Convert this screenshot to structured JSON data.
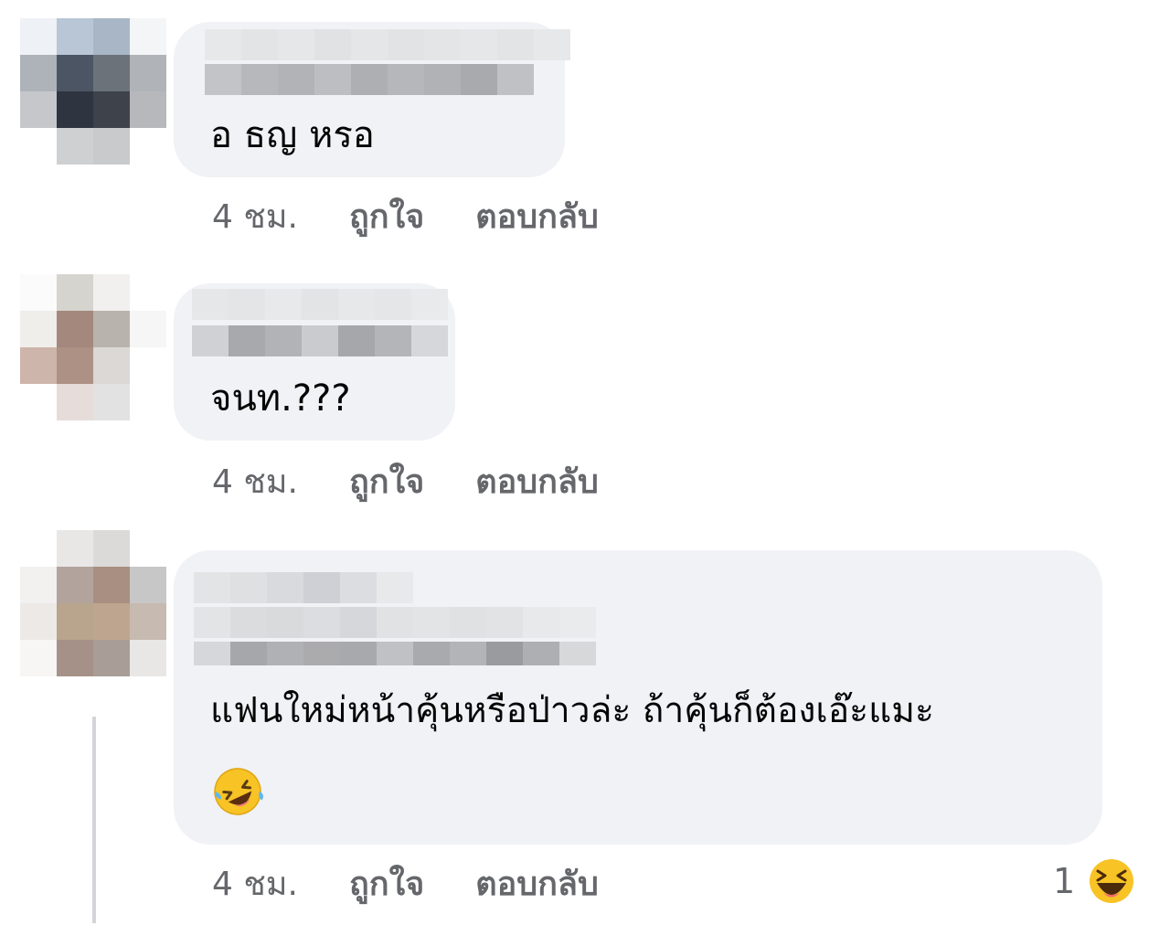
{
  "comments": [
    {
      "text": "อ ธญ หรอ",
      "time": "4 ชม.",
      "like_label": "ถูกใจ",
      "reply_label": "ตอบกลับ"
    },
    {
      "text": "จนท.???",
      "time": "4 ชม.",
      "like_label": "ถูกใจ",
      "reply_label": "ตอบกลับ"
    },
    {
      "text": "แฟนใหม่หน้าคุ้นหรือป่าวล่ะ ถ้าคุ้นก็ต้องเอ๊ะแมะ",
      "emoji": "rolling-on-floor-laughing-emoji",
      "time": "4 ชม.",
      "like_label": "ถูกใจ",
      "reply_label": "ตอบกลับ",
      "reaction_count": "1",
      "reaction_icon": "haha-reaction-icon"
    }
  ],
  "colors": {
    "bubble": "#f0f2f5",
    "meta_text": "#65676b",
    "body_text": "#050505",
    "emoji_yellow": "#f7c325"
  }
}
